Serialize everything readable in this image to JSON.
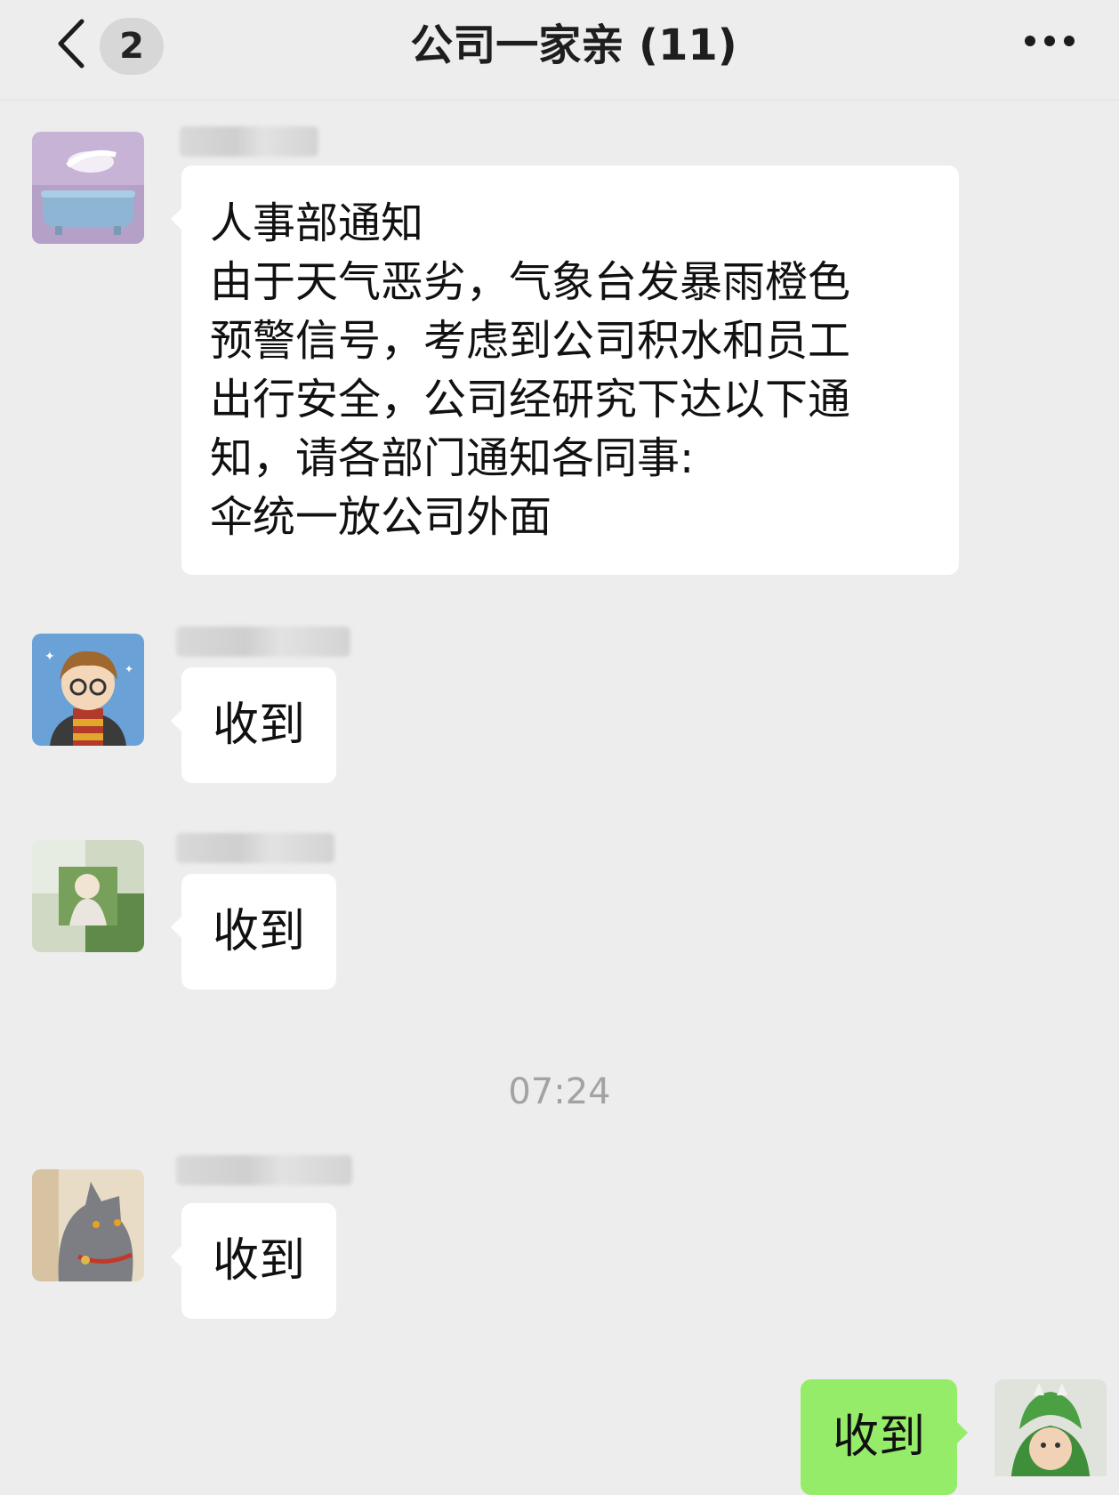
{
  "header": {
    "back_icon": "chevron-left-icon",
    "unread_badge": "2",
    "title": "公司一家亲 (11)",
    "more_icon": "more-dots-icon"
  },
  "messages": [
    {
      "sender": "███ ██",
      "avatar_icon": "bathtub-avatar-icon",
      "lines": [
        "人事部通知",
        "由于天气恶劣，气象台发暴雨橙色",
        "预警信号，考虑到公司积水和员工",
        "出行安全，公司经研究下达以下通",
        "知，请各部门通知各同事:",
        "伞统一放公司外面"
      ]
    },
    {
      "sender": "████ ██",
      "avatar_icon": "cartoon-boy-avatar-icon",
      "text": "收到"
    },
    {
      "sender": "███ ███",
      "avatar_icon": "photo-avatar-icon",
      "text": "收到"
    },
    {
      "sender": "█████ ███",
      "avatar_icon": "cat-avatar-icon",
      "text": "收到"
    }
  ],
  "timestamp": "07:24",
  "self_message": {
    "text": "收到",
    "avatar_icon": "child-dinosaur-avatar-icon"
  },
  "colors": {
    "background": "#ededed",
    "bubble_received": "#ffffff",
    "bubble_sent": "#95ec69"
  }
}
